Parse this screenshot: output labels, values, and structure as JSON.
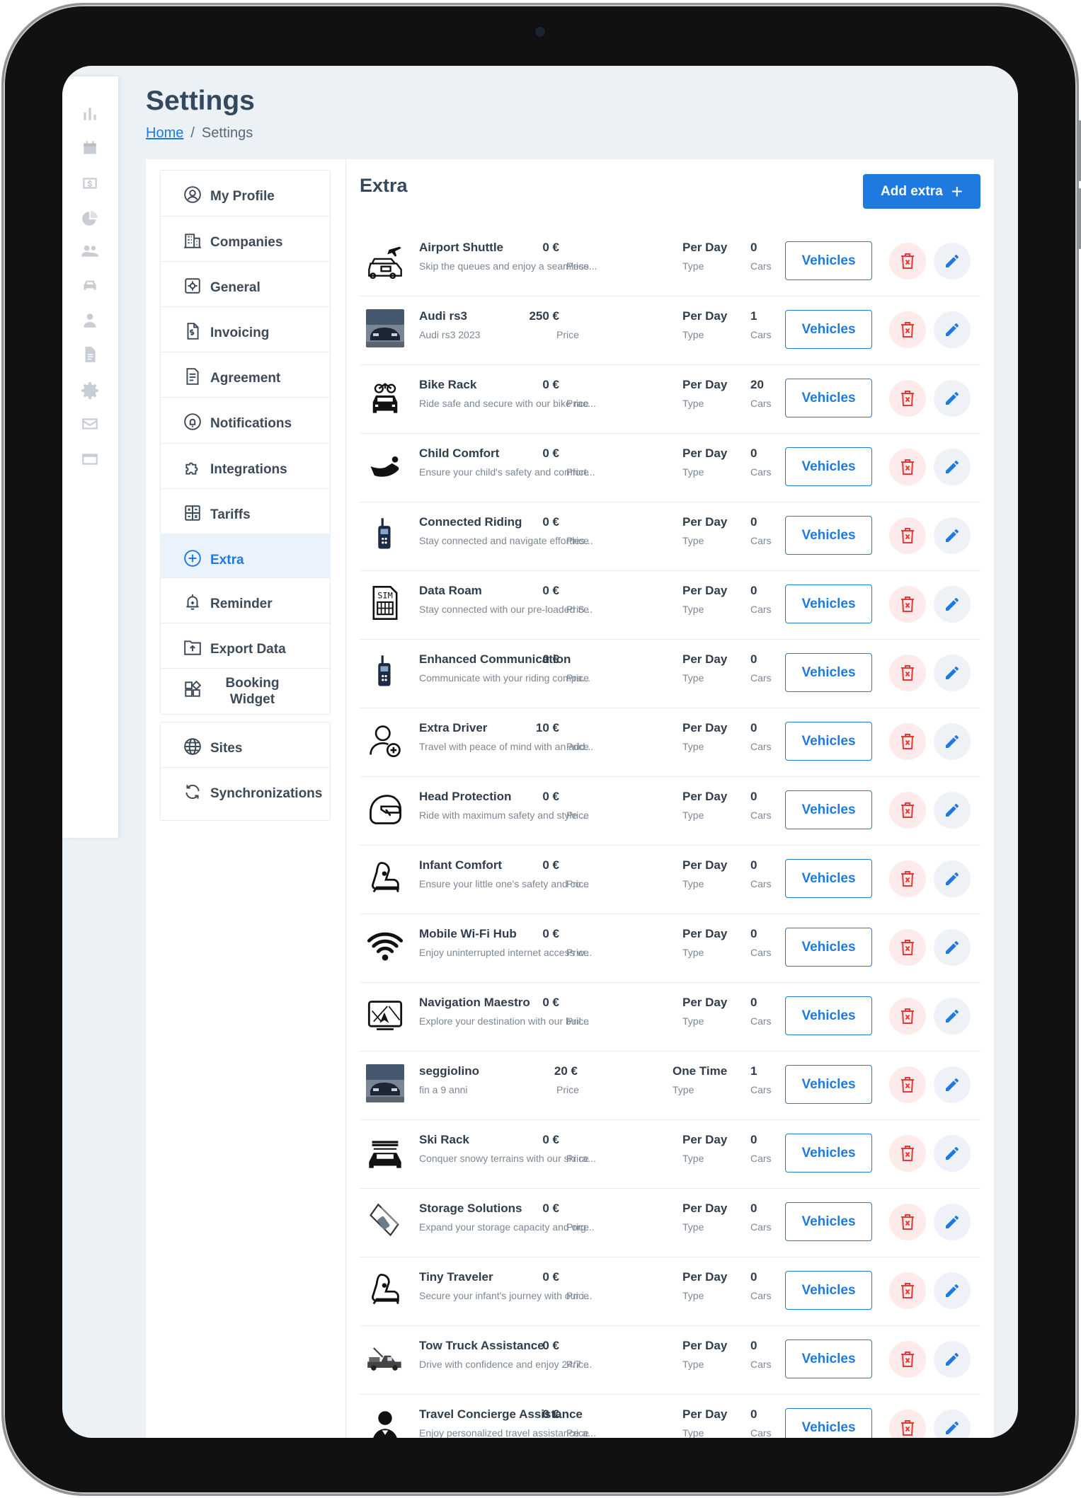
{
  "page": {
    "title": "Settings"
  },
  "breadcrumb": {
    "home": "Home",
    "separator": "/",
    "current": "Settings"
  },
  "rail_icons": [
    "bar-chart-icon",
    "calendar-icon",
    "dollar-icon",
    "pie-chart-icon",
    "users-icon",
    "car-icon",
    "person-icon",
    "document-icon",
    "gear-icon",
    "mail-icon",
    "credit-card-icon"
  ],
  "menu": {
    "items": [
      {
        "label": "My Profile",
        "icon": "profile-icon"
      },
      {
        "label": "Companies",
        "icon": "building-icon"
      },
      {
        "label": "General",
        "icon": "settings-icon"
      },
      {
        "label": "Invoicing",
        "icon": "invoice-icon"
      },
      {
        "label": "Agreement",
        "icon": "agreement-icon"
      },
      {
        "label": "Notifications",
        "icon": "bell-icon"
      },
      {
        "label": "Integrations",
        "icon": "puzzle-icon"
      },
      {
        "label": "Tariffs",
        "icon": "calculator-icon"
      },
      {
        "label": "Extra",
        "icon": "plus-circle-icon",
        "active": true
      },
      {
        "label": "Reminder",
        "icon": "reminder-icon"
      },
      {
        "label": "Export Data",
        "icon": "export-icon"
      },
      {
        "label": "Booking Widget",
        "icon": "widget-icon"
      },
      {
        "label": "Sites",
        "icon": "globe-icon"
      },
      {
        "label": "Synchronizations",
        "icon": "sync-icon"
      }
    ]
  },
  "extra": {
    "title": "Extra",
    "add_label": "Add extra",
    "price_label": "Price",
    "type_label": "Type",
    "cars_label": "Cars",
    "vehicles_label": "Vehicles",
    "rows": [
      {
        "name": "Airport Shuttle",
        "desc": "Skip the queues and enjoy a seamless...",
        "price": "0 €",
        "type": "Per Day",
        "cars": "0",
        "icon": "airport-shuttle-icon"
      },
      {
        "name": "Audi rs3",
        "desc": "Audi rs3 2023",
        "price": "250 €",
        "type": "Per Day",
        "cars": "1",
        "icon": "car-photo"
      },
      {
        "name": "Bike Rack",
        "desc": "Ride safe and secure with our bike rac...",
        "price": "0 €",
        "type": "Per Day",
        "cars": "20",
        "icon": "bike-rack-icon"
      },
      {
        "name": "Child Comfort",
        "desc": "Ensure your child's safety and comfort...",
        "price": "0 €",
        "type": "Per Day",
        "cars": "0",
        "icon": "child-seat-icon"
      },
      {
        "name": "Connected Riding",
        "desc": "Stay connected and navigate effortles...",
        "price": "0 €",
        "type": "Per Day",
        "cars": "0",
        "icon": "walkie-talkie-icon"
      },
      {
        "name": "Data Roam",
        "desc": "Stay connected with our pre-loaded S...",
        "price": "0 €",
        "type": "Per Day",
        "cars": "0",
        "icon": "sim-card-icon"
      },
      {
        "name": "Enhanced Communication",
        "desc": "Communicate with your riding compa...",
        "price": "0 €",
        "type": "Per Day",
        "cars": "0",
        "icon": "walkie-talkie-icon"
      },
      {
        "name": "Extra Driver",
        "desc": "Travel with peace of mind with an add...",
        "price": "10 €",
        "type": "Per Day",
        "cars": "0",
        "icon": "add-driver-icon"
      },
      {
        "name": "Head Protection",
        "desc": "Ride with maximum safety and style ...",
        "price": "0 €",
        "type": "Per Day",
        "cars": "0",
        "icon": "helmet-icon"
      },
      {
        "name": "Infant Comfort",
        "desc": "Ensure your little one's safety and co...",
        "price": "0 €",
        "type": "Per Day",
        "cars": "0",
        "icon": "car-seat-icon"
      },
      {
        "name": "Mobile Wi-Fi Hub",
        "desc": "Enjoy uninterrupted internet access w...",
        "price": "0 €",
        "type": "Per Day",
        "cars": "0",
        "icon": "wifi-icon"
      },
      {
        "name": "Navigation Maestro",
        "desc": "Explore your destination with our buil...",
        "price": "0 €",
        "type": "Per Day",
        "cars": "0",
        "icon": "gps-icon"
      },
      {
        "name": "seggiolino",
        "desc": "fin a 9 anni",
        "price": "20 €",
        "type": "One Time",
        "cars": "1",
        "icon": "car-photo"
      },
      {
        "name": "Ski Rack",
        "desc": "Conquer snowy terrains with our ski ra...",
        "price": "0 €",
        "type": "Per Day",
        "cars": "0",
        "icon": "ski-rack-icon"
      },
      {
        "name": "Storage Solutions",
        "desc": "Expand your storage capacity and org...",
        "price": "0 €",
        "type": "Per Day",
        "cars": "0",
        "icon": "storage-icon"
      },
      {
        "name": "Tiny Traveler",
        "desc": "Secure your infant's journey with our i...",
        "price": "0 €",
        "type": "Per Day",
        "cars": "0",
        "icon": "car-seat-icon"
      },
      {
        "name": "Tow Truck Assistance",
        "desc": "Drive with confidence and enjoy 24/7 ...",
        "price": "0 €",
        "type": "Per Day",
        "cars": "0",
        "icon": "tow-truck-icon"
      },
      {
        "name": "Travel Concierge Assistance",
        "desc": "Enjoy personalized travel assistance a...",
        "price": "0 €",
        "type": "Per Day",
        "cars": "0",
        "icon": "concierge-icon"
      }
    ]
  }
}
